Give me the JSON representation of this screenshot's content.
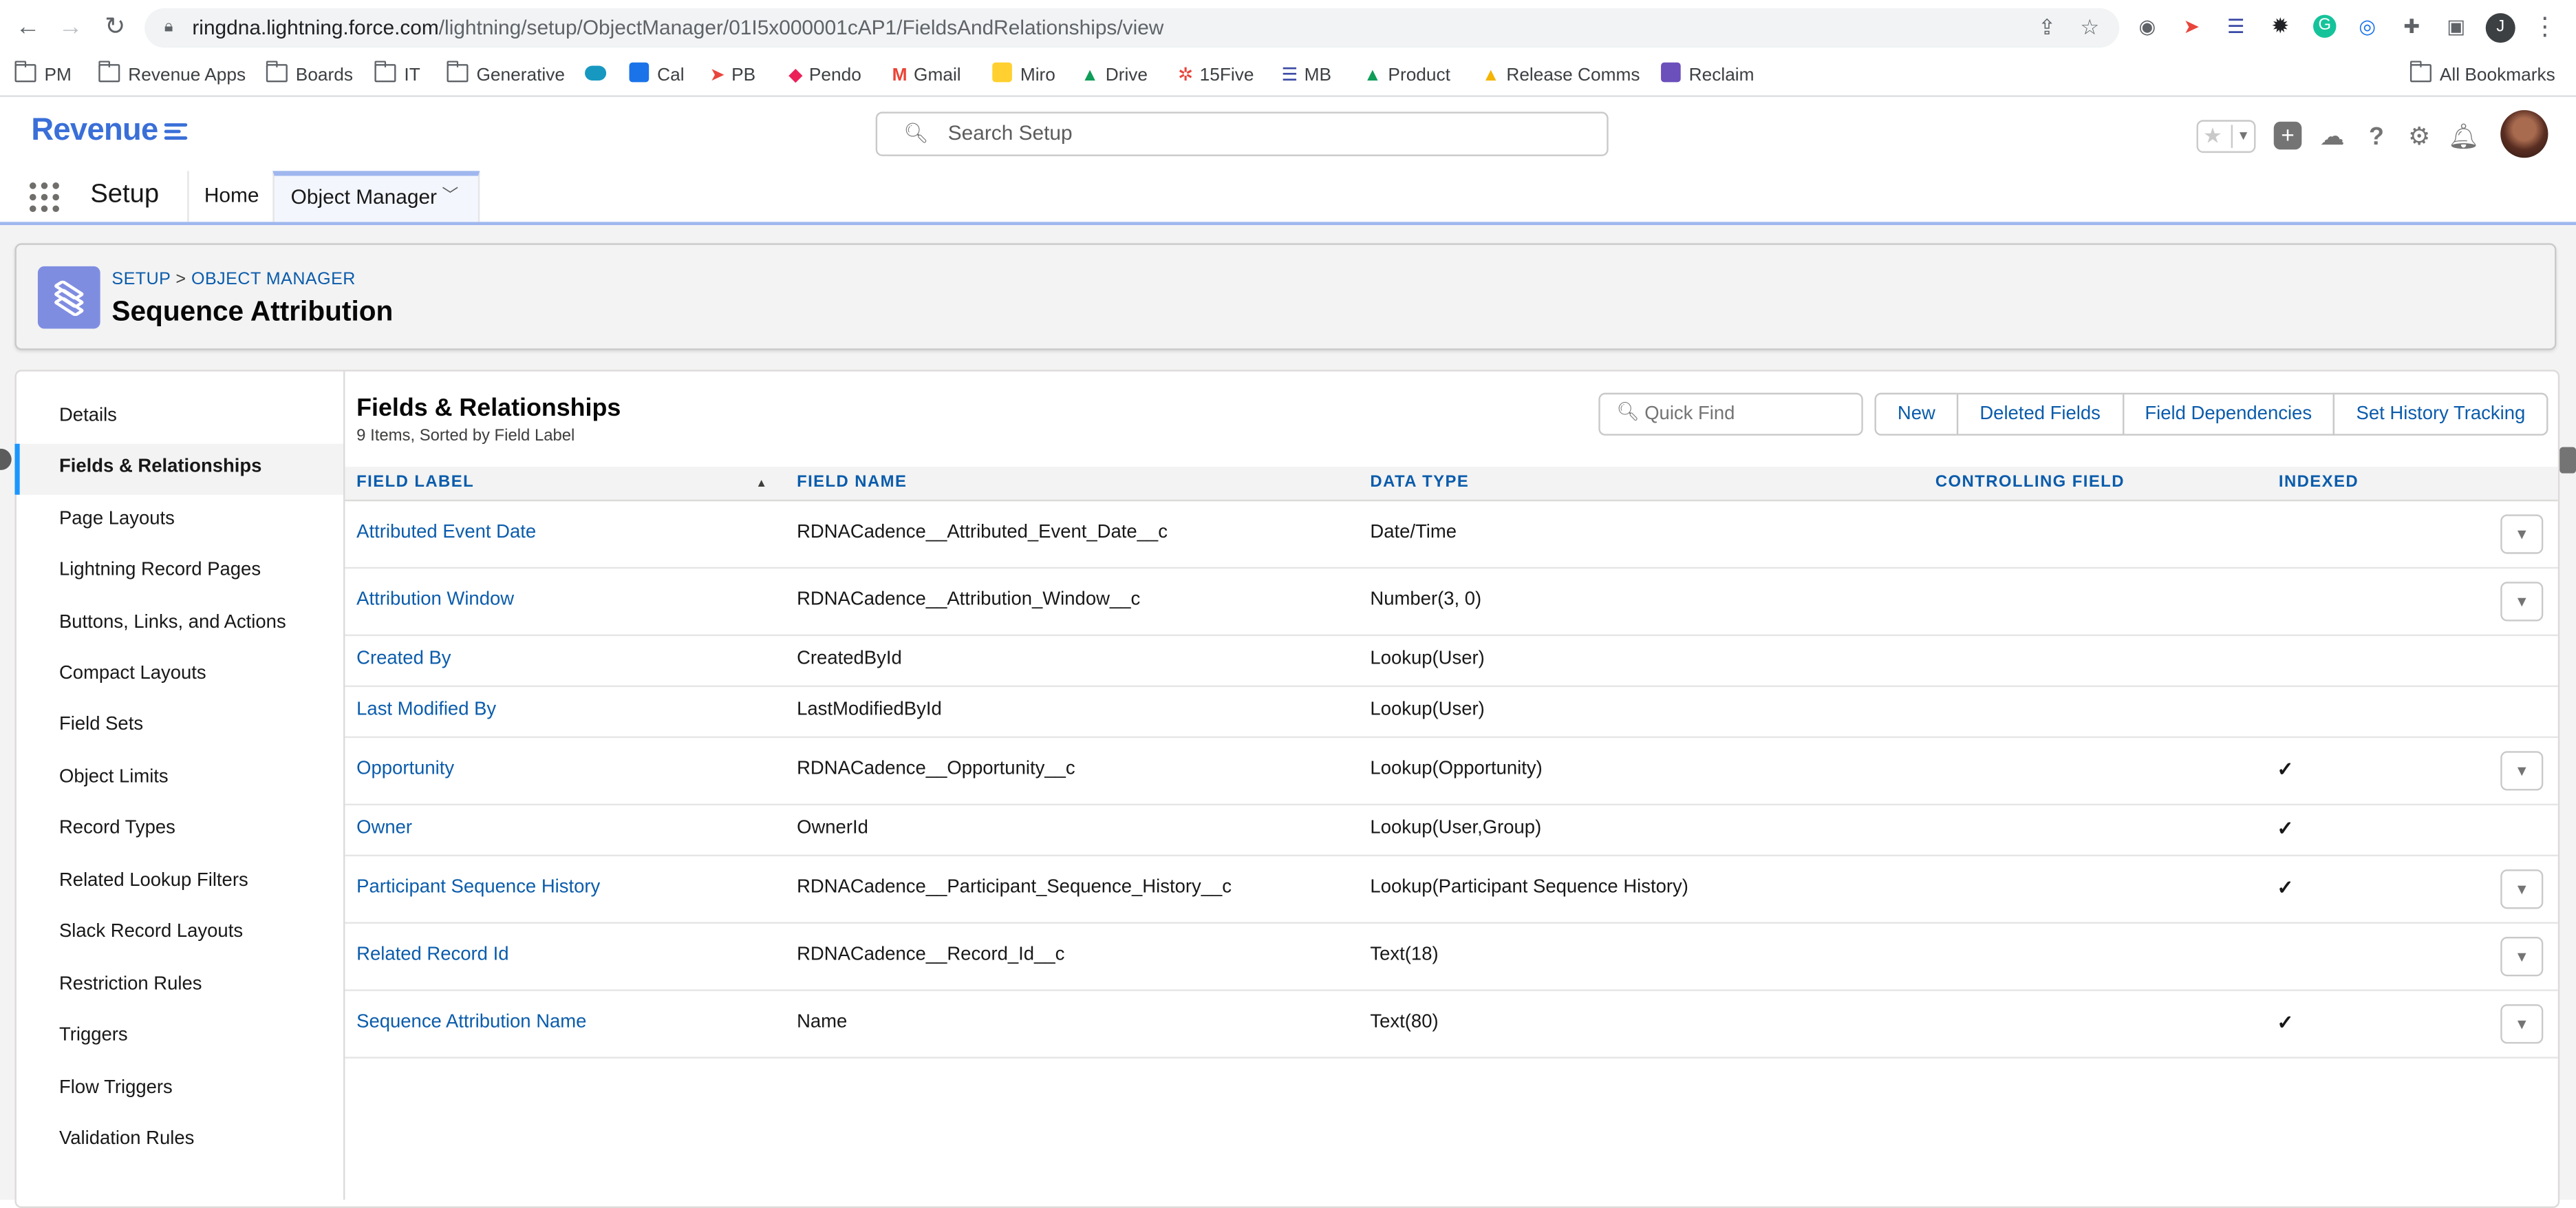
{
  "browser": {
    "url_host": "ringdna.lightning.force.com",
    "url_path": "/lightning/setup/ObjectManager/01I5x000001cAP1/FieldsAndRelationships/view",
    "profile_initial": "J",
    "bookmarks": [
      "PM",
      "Revenue Apps",
      "Boards",
      "IT",
      "Generative",
      "",
      "Cal",
      "PB",
      "Pendo",
      "Gmail",
      "Miro",
      "Drive",
      "15Five",
      "MB",
      "Product",
      "Release Comms",
      "Reclaim"
    ],
    "all_bookmarks": "All Bookmarks"
  },
  "header": {
    "logo_text": "Revenue",
    "search_placeholder": "Search Setup"
  },
  "appnav": {
    "app_name": "Setup",
    "tabs": [
      "Home",
      "Object Manager"
    ]
  },
  "page_header": {
    "breadcrumb_setup": "SETUP",
    "breadcrumb_sep": ">",
    "breadcrumb_om": "OBJECT MANAGER",
    "title": "Sequence Attribution"
  },
  "sidebar": {
    "items": [
      "Details",
      "Fields & Relationships",
      "Page Layouts",
      "Lightning Record Pages",
      "Buttons, Links, and Actions",
      "Compact Layouts",
      "Field Sets",
      "Object Limits",
      "Record Types",
      "Related Lookup Filters",
      "Slack Record Layouts",
      "Restriction Rules",
      "Triggers",
      "Flow Triggers",
      "Validation Rules"
    ],
    "active_index": 1
  },
  "list": {
    "title": "Fields & Relationships",
    "subtitle": "9 Items, Sorted by Field Label",
    "quick_find_placeholder": "Quick Find",
    "buttons": [
      "New",
      "Deleted Fields",
      "Field Dependencies",
      "Set History Tracking"
    ],
    "columns": [
      "FIELD LABEL",
      "FIELD NAME",
      "DATA TYPE",
      "CONTROLLING FIELD",
      "INDEXED"
    ],
    "rows": [
      {
        "label": "Attributed Event Date",
        "name": "RDNACadence__Attributed_Event_Date__c",
        "type": "Date/Time",
        "controlling": "",
        "indexed": false,
        "actions": true
      },
      {
        "label": "Attribution Window",
        "name": "RDNACadence__Attribution_Window__c",
        "type": "Number(3, 0)",
        "controlling": "",
        "indexed": false,
        "actions": true
      },
      {
        "label": "Created By",
        "name": "CreatedById",
        "type": "Lookup(User)",
        "controlling": "",
        "indexed": false,
        "actions": false
      },
      {
        "label": "Last Modified By",
        "name": "LastModifiedById",
        "type": "Lookup(User)",
        "controlling": "",
        "indexed": false,
        "actions": false
      },
      {
        "label": "Opportunity",
        "name": "RDNACadence__Opportunity__c",
        "type": "Lookup(Opportunity)",
        "controlling": "",
        "indexed": true,
        "actions": true
      },
      {
        "label": "Owner",
        "name": "OwnerId",
        "type": "Lookup(User,Group)",
        "controlling": "",
        "indexed": true,
        "actions": false
      },
      {
        "label": "Participant Sequence History",
        "name": "RDNACadence__Participant_Sequence_History__c",
        "type": "Lookup(Participant Sequence History)",
        "controlling": "",
        "indexed": true,
        "actions": true
      },
      {
        "label": "Related Record Id",
        "name": "RDNACadence__Record_Id__c",
        "type": "Text(18)",
        "controlling": "",
        "indexed": false,
        "actions": true
      },
      {
        "label": "Sequence Attribution Name",
        "name": "Name",
        "type": "Text(80)",
        "controlling": "",
        "indexed": true,
        "actions": true
      }
    ]
  },
  "colors": {
    "link": "#0b5cab",
    "object_icon": "#7f8de1",
    "active_bar": "#1b96ff"
  }
}
